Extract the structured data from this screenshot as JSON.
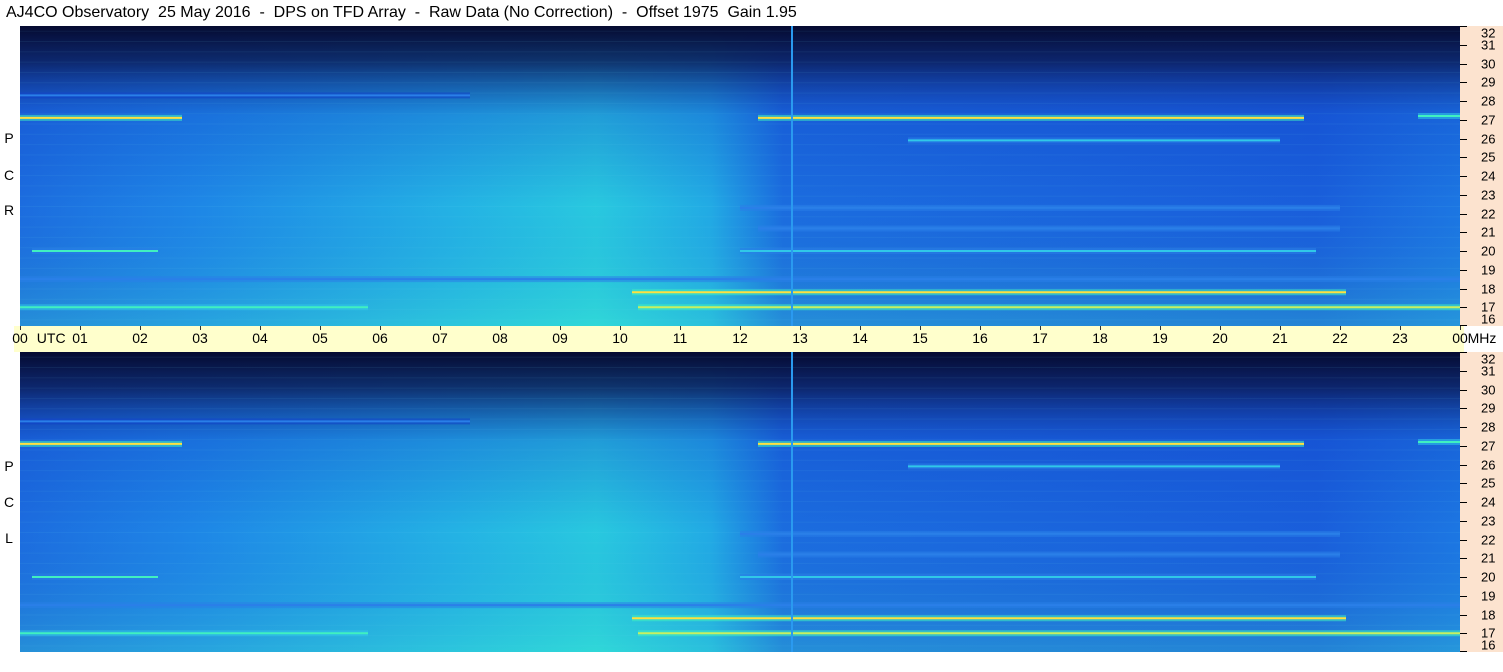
{
  "title": "AJ4CO Observatory  25 May 2016  -  DPS on TFD Array  -  Raw Data (No Correction)  -  Offset 1975  Gain 1.95",
  "panels": [
    {
      "name": "RCP",
      "letters": [
        "P",
        "C",
        "R"
      ]
    },
    {
      "name": "LCP",
      "letters": [
        "P",
        "C",
        "L"
      ]
    }
  ],
  "chart_data": {
    "type": "heatmap",
    "x_ticks": [
      "00",
      "01",
      "02",
      "03",
      "04",
      "05",
      "06",
      "07",
      "08",
      "09",
      "10",
      "11",
      "12",
      "13",
      "14",
      "15",
      "16",
      "17",
      "18",
      "19",
      "20",
      "21",
      "22",
      "23",
      "00"
    ],
    "x_unit_label": "UTC",
    "y_unit_label": "MHz",
    "y_ticks": [
      16,
      17,
      18,
      19,
      20,
      21,
      22,
      23,
      24,
      25,
      26,
      27,
      28,
      29,
      30,
      31,
      32
    ],
    "xlim": [
      0,
      24
    ],
    "ylim": [
      16,
      32
    ],
    "colormap": [
      "#0a1a4a",
      "#1040c8",
      "#2a7fe8",
      "#30c8e8",
      "#40f0c0",
      "#c8f060",
      "#ffe040",
      "#ff5080"
    ],
    "background_color": "#1e8ae6",
    "strong_bands": [
      {
        "freq": 27.1,
        "t_start": 0.0,
        "t_end": 2.7,
        "intensity": 0.9
      },
      {
        "freq": 27.1,
        "t_start": 12.3,
        "t_end": 21.4,
        "intensity": 0.85
      },
      {
        "freq": 27.2,
        "t_start": 23.3,
        "t_end": 24.0,
        "intensity": 0.6
      },
      {
        "freq": 17.8,
        "t_start": 10.2,
        "t_end": 22.1,
        "intensity": 0.9
      },
      {
        "freq": 17.0,
        "t_start": 10.3,
        "t_end": 24.0,
        "intensity": 0.75
      },
      {
        "freq": 17.0,
        "t_start": 0.0,
        "t_end": 5.8,
        "intensity": 0.55
      },
      {
        "freq": 20.0,
        "t_start": 0.2,
        "t_end": 2.3,
        "intensity": 0.5
      },
      {
        "freq": 20.0,
        "t_start": 12.0,
        "t_end": 21.6,
        "intensity": 0.45
      },
      {
        "freq": 25.9,
        "t_start": 14.8,
        "t_end": 21.0,
        "intensity": 0.4
      },
      {
        "freq": 22.3,
        "t_start": 12.0,
        "t_end": 22.0,
        "intensity": 0.35
      },
      {
        "freq": 21.2,
        "t_start": 12.3,
        "t_end": 22.0,
        "intensity": 0.35
      },
      {
        "freq": 18.5,
        "t_start": 0.0,
        "t_end": 24.0,
        "intensity": 0.35
      },
      {
        "freq": 28.3,
        "t_start": 0.0,
        "t_end": 7.5,
        "intensity": 0.25
      }
    ],
    "vertical_lines": [
      12.85
    ]
  }
}
